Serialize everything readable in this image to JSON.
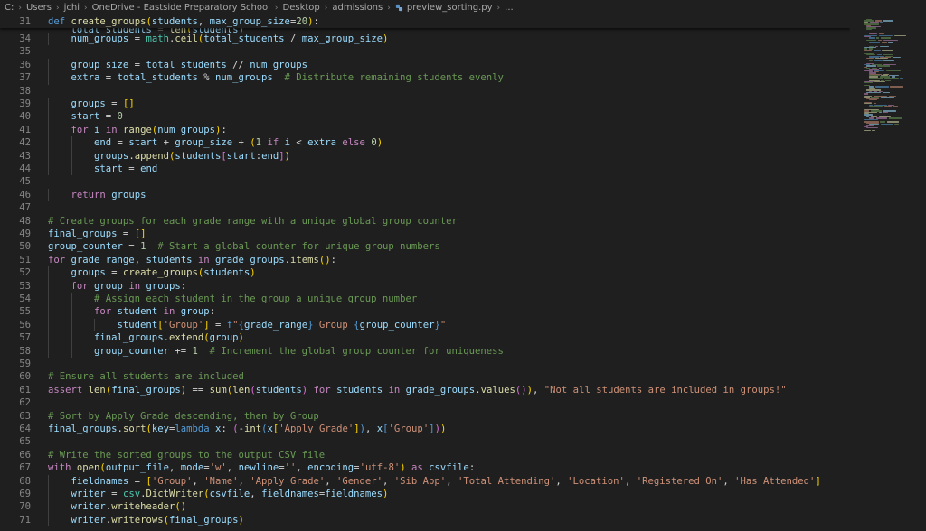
{
  "breadcrumbs": [
    "C:",
    "Users",
    "jchi",
    "OneDrive - Eastside Preparatory School",
    "Desktop",
    "admissions",
    "preview_sorting.py",
    "..."
  ],
  "sticky_line": {
    "num": "31",
    "text": "def create_groups(students, max_group_size=20):"
  },
  "ghost_text": "total_students = len(students)",
  "lines": [
    {
      "n": "34",
      "text": "    num_groups = math.ceil(total_students / max_group_size)"
    },
    {
      "n": "35",
      "text": ""
    },
    {
      "n": "36",
      "text": "    group_size = total_students // num_groups"
    },
    {
      "n": "37",
      "text": "    extra = total_students % num_groups  # Distribute remaining students evenly"
    },
    {
      "n": "38",
      "text": ""
    },
    {
      "n": "39",
      "text": "    groups = []"
    },
    {
      "n": "40",
      "text": "    start = 0"
    },
    {
      "n": "41",
      "text": "    for i in range(num_groups):"
    },
    {
      "n": "42",
      "text": "        end = start + group_size + (1 if i < extra else 0)"
    },
    {
      "n": "43",
      "text": "        groups.append(students[start:end])"
    },
    {
      "n": "44",
      "text": "        start = end"
    },
    {
      "n": "45",
      "text": ""
    },
    {
      "n": "46",
      "text": "    return groups"
    },
    {
      "n": "47",
      "text": ""
    },
    {
      "n": "48",
      "text": "# Create groups for each grade range with a unique global group counter"
    },
    {
      "n": "49",
      "text": "final_groups = []"
    },
    {
      "n": "50",
      "text": "group_counter = 1  # Start a global counter for unique group numbers"
    },
    {
      "n": "51",
      "text": "for grade_range, students in grade_groups.items():"
    },
    {
      "n": "52",
      "text": "    groups = create_groups(students)"
    },
    {
      "n": "53",
      "text": "    for group in groups:"
    },
    {
      "n": "54",
      "text": "        # Assign each student in the group a unique group number"
    },
    {
      "n": "55",
      "text": "        for student in group:"
    },
    {
      "n": "56",
      "text": "            student['Group'] = f\"{grade_range} Group {group_counter}\""
    },
    {
      "n": "57",
      "text": "        final_groups.extend(group)"
    },
    {
      "n": "58",
      "text": "        group_counter += 1  # Increment the global group counter for uniqueness"
    },
    {
      "n": "59",
      "text": ""
    },
    {
      "n": "60",
      "text": "# Ensure all students are included"
    },
    {
      "n": "61",
      "text": "assert len(final_groups) == sum(len(students) for students in grade_groups.values()), \"Not all students are included in groups!\""
    },
    {
      "n": "62",
      "text": ""
    },
    {
      "n": "63",
      "text": "# Sort by Apply Grade descending, then by Group"
    },
    {
      "n": "64",
      "text": "final_groups.sort(key=lambda x: (-int(x['Apply Grade']), x['Group']))"
    },
    {
      "n": "65",
      "text": ""
    },
    {
      "n": "66",
      "text": "# Write the sorted groups to the output CSV file"
    },
    {
      "n": "67",
      "text": "with open(output_file, mode='w', newline='', encoding='utf-8') as csvfile:"
    },
    {
      "n": "68",
      "text": "    fieldnames = ['Group', 'Name', 'Apply Grade', 'Gender', 'Sib App', 'Total Attending', 'Location', 'Registered On', 'Has Attended']"
    },
    {
      "n": "69",
      "text": "    writer = csv.DictWriter(csvfile, fieldnames=fieldnames)"
    },
    {
      "n": "70",
      "text": "    writer.writeheader()"
    },
    {
      "n": "71",
      "text": "    writer.writerows(final_groups)"
    }
  ],
  "colors": {
    "background": "#1f1f1f",
    "keyword": "#c586c0",
    "def": "#569cd6",
    "function": "#dcdcaa",
    "variable": "#9cdcfe",
    "string": "#ce9178",
    "number": "#b5cea8",
    "comment": "#6a9955",
    "line_number": "#858585"
  }
}
